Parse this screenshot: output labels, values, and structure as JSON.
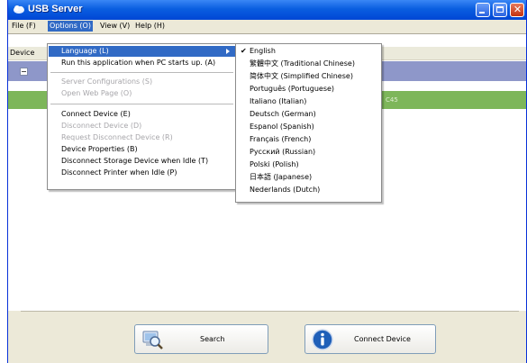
{
  "window": {
    "title": "USB Server"
  },
  "colors": {
    "title_bar": "#0046d5",
    "menu_highlight": "#316ac5",
    "header_band": "#8e97c9",
    "device_row": "#7db65a"
  },
  "menubar": {
    "file": "File (F)",
    "options": "Options (O)",
    "view": "View (V)",
    "help": "Help (H)"
  },
  "list": {
    "column_device": "Device",
    "row_text": "C45"
  },
  "options_menu": {
    "items": [
      {
        "label": "Language (L)",
        "state": "highlighted",
        "submenu": true
      },
      {
        "label": "Run this application when PC starts up. (A)",
        "state": "enabled"
      },
      {
        "label": "Server Configurations (S)",
        "state": "disabled"
      },
      {
        "label": "Open Web Page (O)",
        "state": "disabled"
      },
      {
        "label": "Connect Device (E)",
        "state": "enabled"
      },
      {
        "label": "Disconnect Device (D)",
        "state": "disabled"
      },
      {
        "label": "Request Disconnect Device (R)",
        "state": "disabled"
      },
      {
        "label": "Device Properties (B)",
        "state": "enabled"
      },
      {
        "label": "Disconnect Storage Device when Idle (T)",
        "state": "enabled"
      },
      {
        "label": "Disconnect Printer when Idle (P)",
        "state": "enabled"
      }
    ]
  },
  "language_menu": {
    "checked": "English",
    "items": [
      "English",
      "繁體中文 (Traditional Chinese)",
      "简体中文 (Simplified Chinese)",
      "Português (Portuguese)",
      "Italiano (Italian)",
      "Deutsch (German)",
      "Espanol (Spanish)",
      "Français (French)",
      "Русский (Russian)",
      "Polski (Polish)",
      "日本語 (Japanese)",
      "Nederlands (Dutch)"
    ]
  },
  "buttons": {
    "search": "Search",
    "connect": "Connect Device"
  },
  "icons": {
    "title": "usb-cloud-icon",
    "search": "magnifier-computer-icon",
    "connect": "info-icon"
  }
}
